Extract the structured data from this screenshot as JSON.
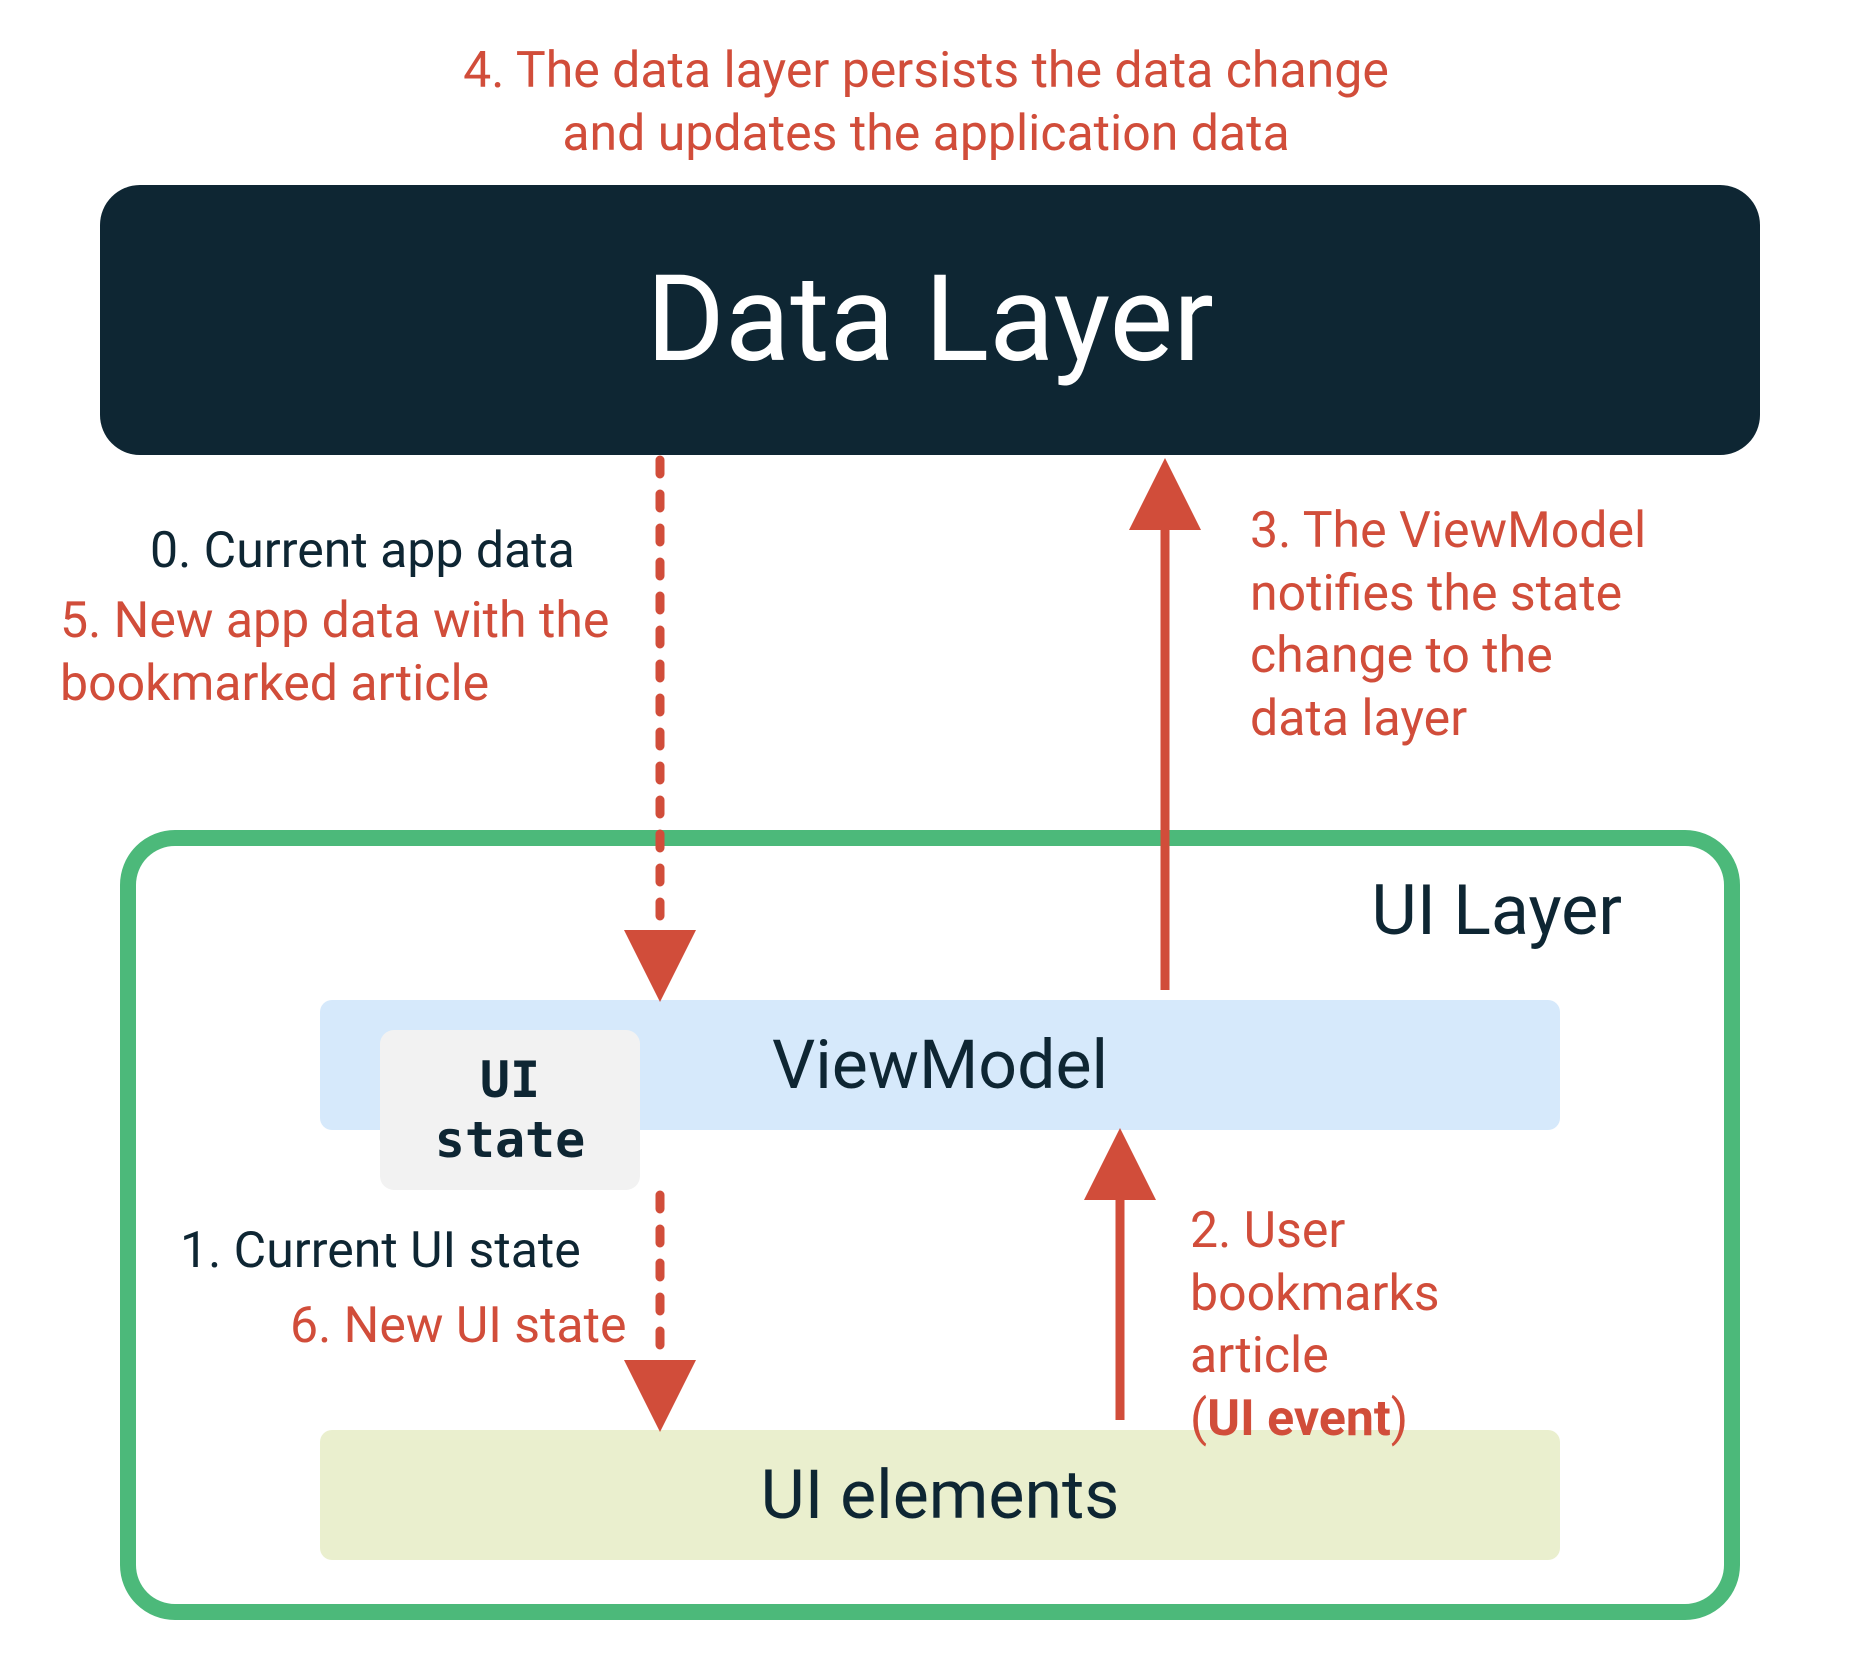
{
  "captionTop": {
    "line1": "4. The data layer persists the data change",
    "line2": "and updates the application data"
  },
  "boxes": {
    "dataLayer": "Data Layer",
    "uiLayerTitle": "UI Layer",
    "viewModel": "ViewModel",
    "uiState": {
      "line1": "UI",
      "line2": "state"
    },
    "uiElements": "UI elements"
  },
  "labels": {
    "step0": "0. Current app data",
    "step5": {
      "line1": "5. New app data with the",
      "line2": "bookmarked article"
    },
    "step3": {
      "line1": "3. The ViewModel",
      "line2": "notifies the state",
      "line3": "change to the",
      "line4": "data layer"
    },
    "step1": "1. Current UI state",
    "step6": "6. New UI state",
    "step2": {
      "line1": "2. User",
      "line2": "bookmarks",
      "line3": "article",
      "line4a": "(",
      "line4b": "UI event",
      "line4c": ")"
    }
  },
  "colors": {
    "dark": "#0e2633",
    "accentRed": "#d14d3a",
    "green": "#4cb97a",
    "lightBlue": "#d6e9fb",
    "lightYellow": "#eaefce",
    "gray": "#f2f2f2"
  }
}
